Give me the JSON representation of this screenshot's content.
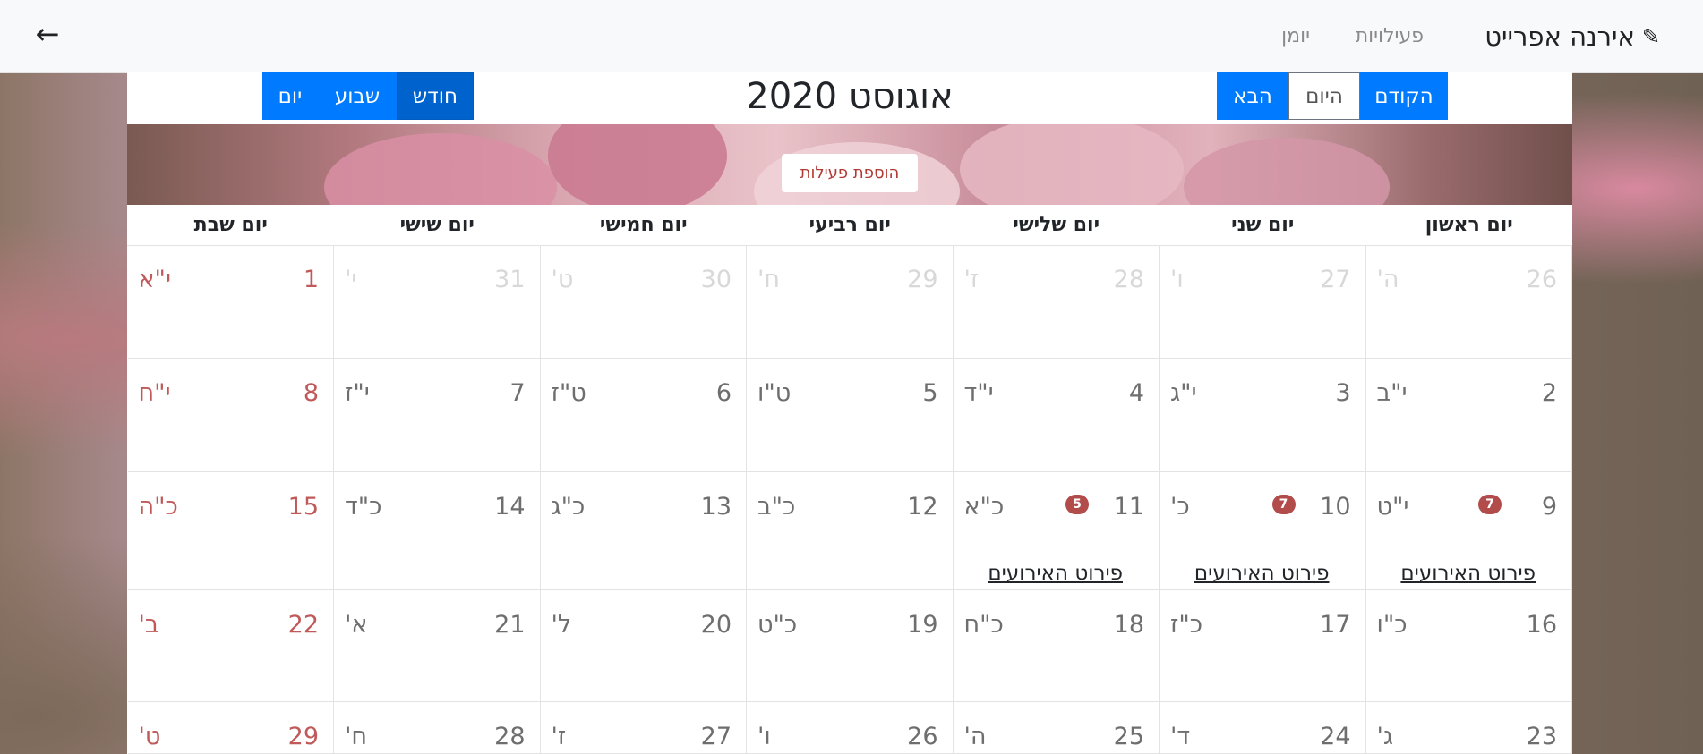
{
  "navbar": {
    "brand_name": "אירנה אפרייט",
    "brand_icon": "pencil-icon",
    "back_icon": "arrow-left-icon",
    "links": {
      "activities": "פעילויות",
      "journal": "יומן"
    }
  },
  "toolbar": {
    "month_title": "אוגוסט 2020",
    "prev": "הקודם",
    "today": "היום",
    "next": "הבא",
    "view_month": "חודש",
    "view_week": "שבוע",
    "view_day": "יום",
    "active_view": "month"
  },
  "add_activity": "הוספת פעילות",
  "colors": {
    "primary": "#007bff",
    "saturday": "#c05a5a",
    "badge": "#b24c4a",
    "muted": "#d8d8d8"
  },
  "days": [
    "יום ראשון",
    "יום שני",
    "יום שלישי",
    "יום רביעי",
    "יום חמישי",
    "יום שישי",
    "יום שבת"
  ],
  "events_link_label": "פירוט האירועים",
  "weeks": [
    [
      {
        "num": "26",
        "heb": "ה'",
        "muted": true
      },
      {
        "num": "27",
        "heb": "ו'",
        "muted": true
      },
      {
        "num": "28",
        "heb": "ז'",
        "muted": true
      },
      {
        "num": "29",
        "heb": "ח'",
        "muted": true
      },
      {
        "num": "30",
        "heb": "ט'",
        "muted": true
      },
      {
        "num": "31",
        "heb": "י'",
        "muted": true
      },
      {
        "num": "1",
        "heb": "י\"א"
      }
    ],
    [
      {
        "num": "2",
        "heb": "י\"ב"
      },
      {
        "num": "3",
        "heb": "י\"ג"
      },
      {
        "num": "4",
        "heb": "י\"ד"
      },
      {
        "num": "5",
        "heb": "ט\"ו"
      },
      {
        "num": "6",
        "heb": "ט\"ז"
      },
      {
        "num": "7",
        "heb": "י\"ז"
      },
      {
        "num": "8",
        "heb": "י\"ח"
      }
    ],
    [
      {
        "num": "9",
        "heb": "י\"ט",
        "badge": "7",
        "link": true
      },
      {
        "num": "10",
        "heb": "כ'",
        "badge": "7",
        "link": true
      },
      {
        "num": "11",
        "heb": "כ\"א",
        "badge": "5",
        "link": true
      },
      {
        "num": "12",
        "heb": "כ\"ב"
      },
      {
        "num": "13",
        "heb": "כ\"ג"
      },
      {
        "num": "14",
        "heb": "כ\"ד"
      },
      {
        "num": "15",
        "heb": "כ\"ה"
      }
    ],
    [
      {
        "num": "16",
        "heb": "כ\"ו"
      },
      {
        "num": "17",
        "heb": "כ\"ז"
      },
      {
        "num": "18",
        "heb": "כ\"ח"
      },
      {
        "num": "19",
        "heb": "כ\"ט"
      },
      {
        "num": "20",
        "heb": "ל'"
      },
      {
        "num": "21",
        "heb": "א'"
      },
      {
        "num": "22",
        "heb": "ב'"
      }
    ],
    [
      {
        "num": "23",
        "heb": "ג'"
      },
      {
        "num": "24",
        "heb": "ד'"
      },
      {
        "num": "25",
        "heb": "ה'"
      },
      {
        "num": "26",
        "heb": "ו'"
      },
      {
        "num": "27",
        "heb": "ז'"
      },
      {
        "num": "28",
        "heb": "ח'"
      },
      {
        "num": "29",
        "heb": "ט'"
      }
    ]
  ]
}
